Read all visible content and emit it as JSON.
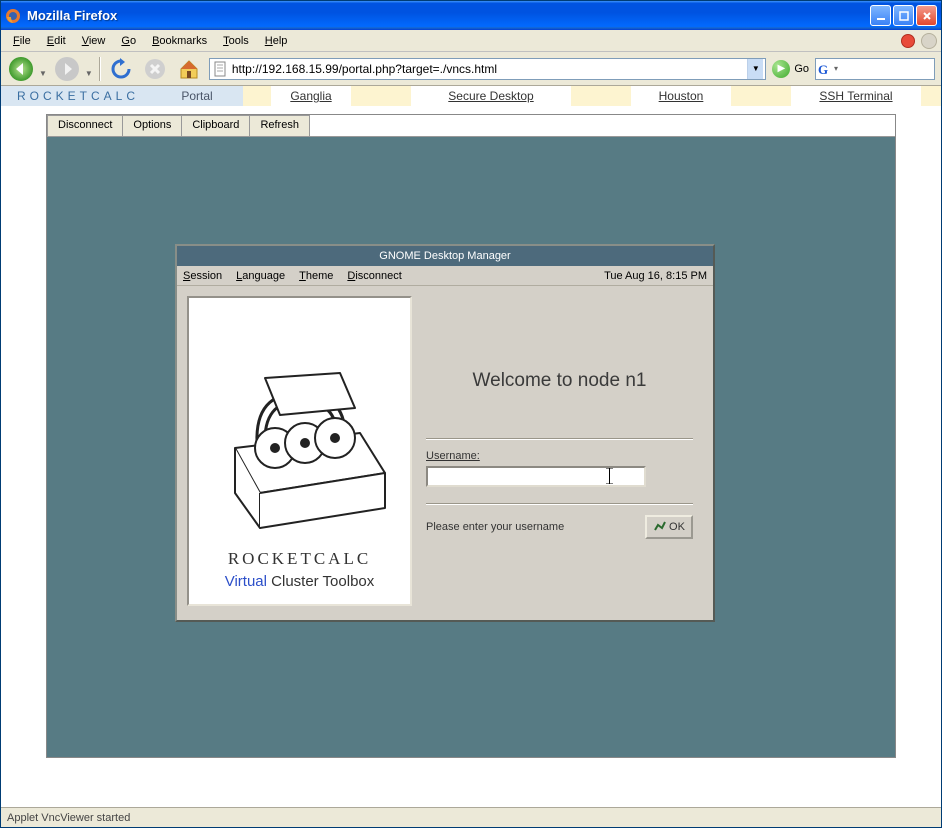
{
  "window": {
    "title": "Mozilla Firefox"
  },
  "menubar": {
    "file": "File",
    "edit": "Edit",
    "view": "View",
    "go": "Go",
    "bookmarks": "Bookmarks",
    "tools": "Tools",
    "help": "Help"
  },
  "toolbar": {
    "url": "http://192.168.15.99/portal.php?target=./vncs.html",
    "go_label": "Go"
  },
  "portal": {
    "brand": "ROCKETCALC",
    "tabs": {
      "portal": "Portal",
      "ganglia": "Ganglia",
      "secure": "Secure Desktop",
      "houston": "Houston",
      "ssh": "SSH Terminal"
    }
  },
  "vnc": {
    "tabs": {
      "disconnect": "Disconnect",
      "options": "Options",
      "clipboard": "Clipboard",
      "refresh": "Refresh"
    }
  },
  "gdm": {
    "title": "GNOME Desktop Manager",
    "menu": {
      "session": "Session",
      "language": "Language",
      "theme": "Theme",
      "disconnect": "Disconnect"
    },
    "clock": "Tue Aug 16,  8:15 PM",
    "logo_top": "ROCKETCALC",
    "logo_virtual": "Virtual",
    "logo_rest": " Cluster Toolbox",
    "welcome": "Welcome to node n1",
    "username_label": "Username:",
    "username_value": "",
    "prompt": "Please enter your username",
    "ok_label": "OK"
  },
  "status": {
    "text": "Applet VncViewer started"
  }
}
